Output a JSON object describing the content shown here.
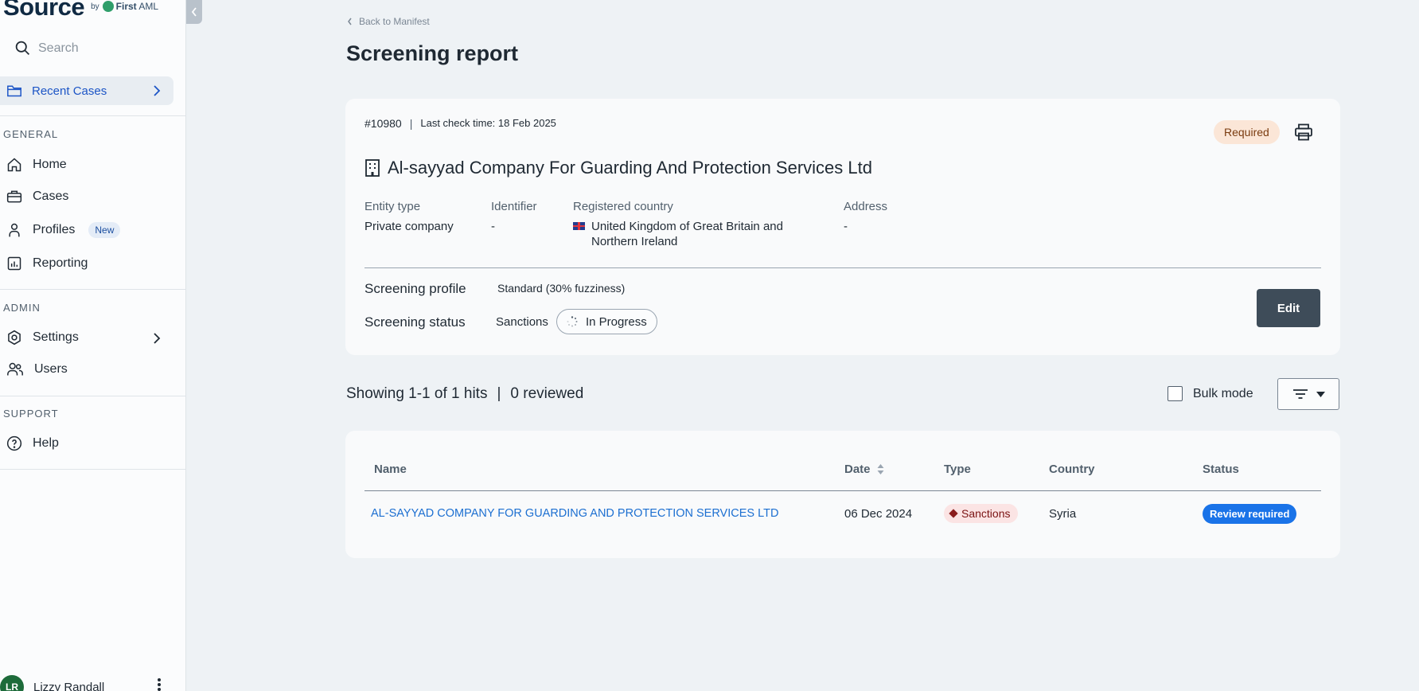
{
  "brand": {
    "word": "Source",
    "by": "by",
    "partner_first": "First",
    "partner_second": "AML"
  },
  "search": {
    "placeholder": "Search"
  },
  "sidebar": {
    "recent_cases": "Recent Cases",
    "general_label": "GENERAL",
    "general_items": [
      "Home",
      "Cases",
      "Profiles",
      "Reporting"
    ],
    "profiles_badge": "New",
    "admin_label": "ADMIN",
    "admin_items": [
      "Settings",
      "Users"
    ],
    "support_label": "SUPPORT",
    "support_items": [
      "Help"
    ]
  },
  "user": {
    "initials": "LR",
    "name": "Lizzy Randall"
  },
  "back_link": "Back to Manifest",
  "page_title": "Screening report",
  "case": {
    "id": "#10980",
    "separator": "|",
    "last_check": "Last check time: 18 Feb 2025",
    "required": "Required",
    "entity_name": "Al-sayyad Company For Guarding And Protection Services Ltd",
    "fields": {
      "entity_type_label": "Entity type",
      "entity_type_value": "Private company",
      "identifier_label": "Identifier",
      "identifier_value": "-",
      "country_label": "Registered country",
      "country_value_line1": "United Kingdom of Great Britain and",
      "country_value_line2": "Northern Ireland",
      "address_label": "Address",
      "address_value": "-"
    },
    "screening_profile_label": "Screening profile",
    "screening_profile_value": "Standard (30% fuzziness)",
    "screening_status_label": "Screening status",
    "screening_status_type": "Sanctions",
    "screening_status_value": "In Progress",
    "edit_label": "Edit"
  },
  "hits": {
    "showing": "Showing 1-1 of 1 hits",
    "separator": "|",
    "reviewed": "0 reviewed",
    "bulk_mode": "Bulk mode"
  },
  "table": {
    "headers": [
      "Name",
      "Date",
      "Type",
      "Country",
      "Status"
    ],
    "rows": [
      {
        "name": "AL-SAYYAD COMPANY FOR GUARDING AND PROTECTION SERVICES LTD",
        "date": "06 Dec 2024",
        "type": "Sanctions",
        "country": "Syria",
        "status": "Review required"
      }
    ]
  },
  "colors": {
    "accent_blue": "#1c55c6",
    "link_blue": "#1c6fd1",
    "status_blue": "#1a73e8",
    "required_bg": "#fbe6d7",
    "sanctions_bg": "#fbe4e4",
    "edit_bg": "#3e4c59",
    "avatar_green": "#1d6b3a"
  }
}
